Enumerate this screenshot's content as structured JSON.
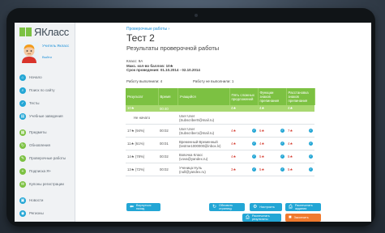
{
  "app": {
    "logo": "ЯКласс"
  },
  "user": {
    "role": "Учитель Якласс",
    "exit": "Выйти"
  },
  "sidebar": {
    "items": [
      {
        "label": "Начало",
        "icon": "home-icon",
        "glyph": "⌂",
        "color": "#23a6d5"
      },
      {
        "label": "Поиск по сайту",
        "icon": "search-icon",
        "glyph": "⌕",
        "color": "#23a6d5"
      },
      {
        "label": "Тесты",
        "icon": "test-icon",
        "glyph": "✓",
        "color": "#23a6d5"
      },
      {
        "label": "Учебные заведения",
        "icon": "school-icon",
        "glyph": "▤",
        "color": "#23a6d5"
      },
      {
        "label": "Предметы",
        "icon": "subjects-icon",
        "glyph": "▦",
        "color": "#7cc142"
      },
      {
        "label": "Обновления",
        "icon": "updates-icon",
        "glyph": "↻",
        "color": "#7cc142"
      },
      {
        "label": "Проверочные работы",
        "icon": "checkwork-icon",
        "glyph": "✎",
        "color": "#7cc142"
      },
      {
        "label": "Подписка Я+",
        "icon": "subscription-icon",
        "glyph": "+",
        "color": "#7cc142"
      },
      {
        "label": "Купоны регистрации",
        "icon": "coupon-icon",
        "glyph": "✉",
        "color": "#7cc142"
      },
      {
        "label": "Новости",
        "icon": "news-icon",
        "glyph": "▣",
        "color": "#23a6d5"
      },
      {
        "label": "Регионы",
        "icon": "regions-icon",
        "glyph": "◉",
        "color": "#23a6d5"
      }
    ]
  },
  "main": {
    "breadcrumb": "Проверочные работы ›",
    "title": "Тест 2",
    "subtitle": "Результаты проверочной работы",
    "meta": {
      "class": "Класс: 9А",
      "max_score": "Макс. кол-во баллов: 10★",
      "period": "Срок проведения: 01.10.2014 - 02.10.2014"
    },
    "done": "Работу выполнили: 4",
    "not_done": "Работу не выполнили: 1"
  },
  "table": {
    "headers": [
      "Результат",
      "Время",
      "Учащийся",
      "Пять сложных предложений",
      "Функции знаков препинания",
      "Расстановка знаков препинания"
    ],
    "summary": [
      "10★",
      "00:40",
      "",
      "4★",
      "4★",
      "4★"
    ],
    "rows": [
      {
        "result": "Не начато",
        "time": "",
        "student": "User User (Subscriber0@mail.ru)",
        "s1": "",
        "s2": "",
        "s3": ""
      },
      {
        "result": "17★ (94%)",
        "time": "00:02",
        "student": "User User (Subscriber1@mail.ru)",
        "s1": "4★",
        "s2": "6★",
        "s3": "7★"
      },
      {
        "result": "11★ (61%)",
        "time": "00:01",
        "student": "Временный Временный (testme1000000@inbox.lv)",
        "s1": "4★",
        "s2": "4★",
        "s3": "4★"
      },
      {
        "result": "14★ (78%)",
        "time": "00:02",
        "student": "Вовочка Класс (vova@yandex.ru)",
        "s1": "4★",
        "s2": "5★",
        "s3": "5★"
      },
      {
        "result": "13★ (72%)",
        "time": "00:02",
        "student": "Ученица Нуль (null@yandex.ru)",
        "s1": "3★",
        "s2": "5★",
        "s3": "5★"
      }
    ]
  },
  "buttons": {
    "back": "Вернуться назад",
    "refresh": "Обновить страницу",
    "settings": "Настроить",
    "print_tasks": "Распечатать задания",
    "print_results": "Распечатать результаты",
    "finish": "Закончить"
  },
  "colors": {
    "accent_green": "#7cc142",
    "accent_blue": "#23a6d5",
    "score_red": "#d43a2e",
    "finish_orange": "#f07a2e"
  }
}
